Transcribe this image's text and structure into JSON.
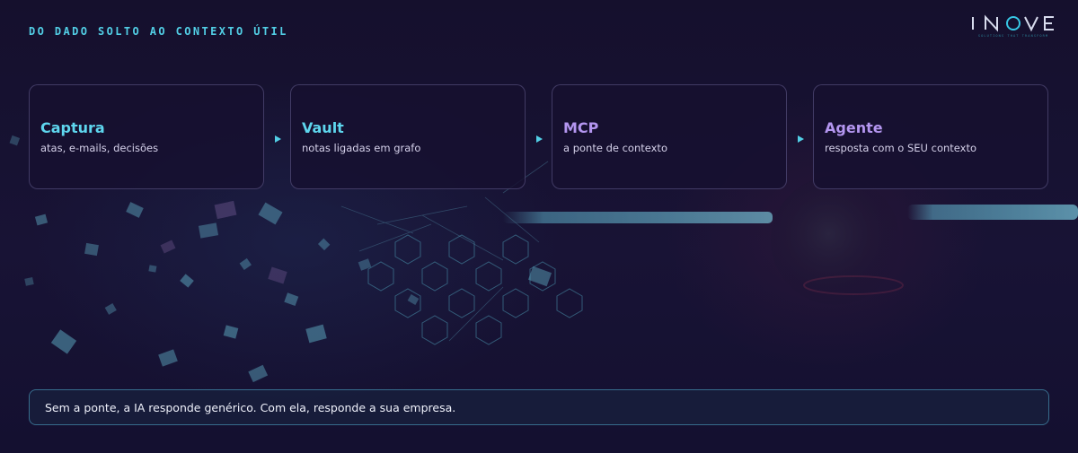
{
  "header": {
    "eyebrow": "DO DADO SOLTO AO CONTEXTO ÚTIL",
    "logo": {
      "wordmark": "INOVE",
      "tagline": "SOLUTIONS THAT TRANSFORM",
      "color": "#d8dcee",
      "accent": "#37c6e4"
    }
  },
  "flow": {
    "arrow_icon": "play-arrow-icon",
    "arrow_color": "#52cfe6",
    "steps": [
      {
        "title": "Captura",
        "subtitle": "atas, e-mails, decisões",
        "color": "#5ed6ee"
      },
      {
        "title": "Vault",
        "subtitle": "notas ligadas em grafo",
        "color": "#5ed6ee"
      },
      {
        "title": "MCP",
        "subtitle": "a ponte de contexto",
        "color": "#b496f0"
      },
      {
        "title": "Agente",
        "subtitle": "resposta com o SEU contexto",
        "color": "#b496f0"
      }
    ]
  },
  "footer": {
    "text": "Sem a ponte, a IA responde genérico. Com ela, responde a sua empresa."
  }
}
